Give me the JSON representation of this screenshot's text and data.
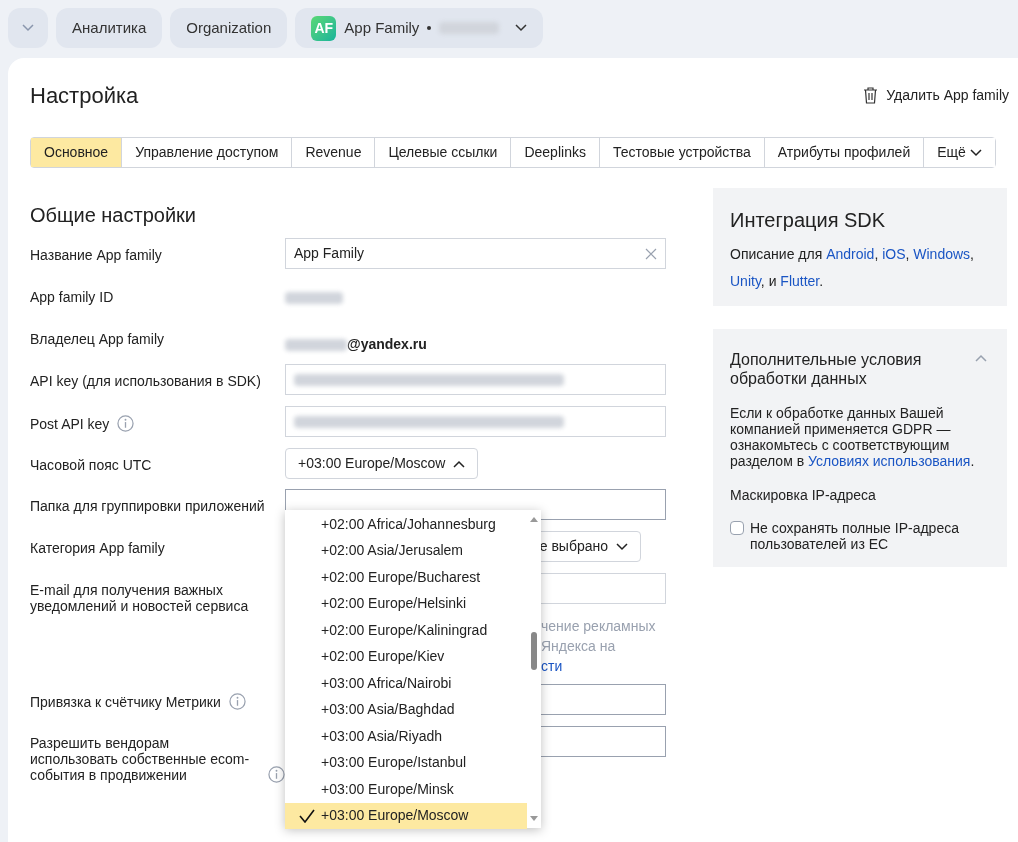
{
  "breadcrumbs": [
    {
      "label": "Аналитика"
    },
    {
      "label": "Organization"
    },
    {
      "label": "App Family",
      "badge": "AF"
    }
  ],
  "header": {
    "title": "Настройка",
    "delete_button": "Удалить App family"
  },
  "tabs": [
    {
      "label": "Основное",
      "selected": true
    },
    {
      "label": "Управление доступом",
      "selected": false
    },
    {
      "label": "Revenue",
      "selected": false
    },
    {
      "label": "Целевые ссылки",
      "selected": false
    },
    {
      "label": "Deeplinks",
      "selected": false
    },
    {
      "label": "Тестовые устройства",
      "selected": false
    },
    {
      "label": "Атрибуты профилей",
      "selected": false
    },
    {
      "label": "Ещё",
      "selected": false
    }
  ],
  "section_title": "Общие настройки",
  "fields": [
    {
      "kind": "input",
      "label": "Название App family",
      "value": "App Family"
    },
    {
      "kind": "redacted",
      "label": "App family ID"
    },
    {
      "kind": "owner",
      "label": "Владелец App family",
      "value": "@yandex.ru"
    },
    {
      "kind": "redacted-input",
      "label": "API key (для использования в SDK)"
    },
    {
      "kind": "redacted-input",
      "label": "Post API key",
      "info": true
    },
    {
      "kind": "select",
      "label": "Часовой пояс UTC",
      "value": "+03:00 Europe/Moscow"
    },
    {
      "kind": "covered",
      "label": "Папка для группировки приложений"
    },
    {
      "kind": "category",
      "label": "Категория App family",
      "value": "е выбрано"
    },
    {
      "kind": "email",
      "label": "E-mail для получения важных уведомлений и новостей сервиса",
      "hint_lines": [
        "чение рекламных",
        "Яндекса на"
      ],
      "hint_link": "сти"
    },
    {
      "kind": "covered",
      "label": "Привязка к счётчику Метрики",
      "info": true
    },
    {
      "kind": "covered",
      "label": "Разрешить вендорам использовать собственные ecom-события в продвижении",
      "info": true
    }
  ],
  "timezone_options": [
    {
      "label": "+02:00 Africa/Johannesburg",
      "selected": false
    },
    {
      "label": "+02:00 Asia/Jerusalem",
      "selected": false
    },
    {
      "label": "+02:00 Europe/Bucharest",
      "selected": false
    },
    {
      "label": "+02:00 Europe/Helsinki",
      "selected": false
    },
    {
      "label": "+02:00 Europe/Kaliningrad",
      "selected": false
    },
    {
      "label": "+02:00 Europe/Kiev",
      "selected": false
    },
    {
      "label": "+03:00 Africa/Nairobi",
      "selected": false
    },
    {
      "label": "+03:00 Asia/Baghdad",
      "selected": false
    },
    {
      "label": "+03:00 Asia/Riyadh",
      "selected": false
    },
    {
      "label": "+03:00 Europe/Istanbul",
      "selected": false
    },
    {
      "label": "+03:00 Europe/Minsk",
      "selected": false
    },
    {
      "label": "+03:00 Europe/Moscow",
      "selected": true
    }
  ],
  "sdk_panel": {
    "title": "Интеграция SDK",
    "text": "Описание для",
    "links": [
      {
        "label": "Android",
        "after": ","
      },
      {
        "label": "iOS",
        "after": ","
      },
      {
        "label": "Windows",
        "after": ","
      },
      {
        "label": "Unity",
        "after": ", и"
      },
      {
        "label": "Flutter",
        "after": "."
      }
    ]
  },
  "privacy_panel": {
    "title": "Дополнительные условия обработки данных",
    "expanded": true,
    "text": "Если к обработке данных Вашей компанией применяется GDPR — ознакомьтесь с соответствующим разделом в",
    "link": "Условиях использования",
    "link_after": ".",
    "subtitle": "Маскировка IP-адреса",
    "checkbox": {
      "label": "Не сохранять полные IP-адреса пользователей из ЕС",
      "checked": false
    }
  }
}
